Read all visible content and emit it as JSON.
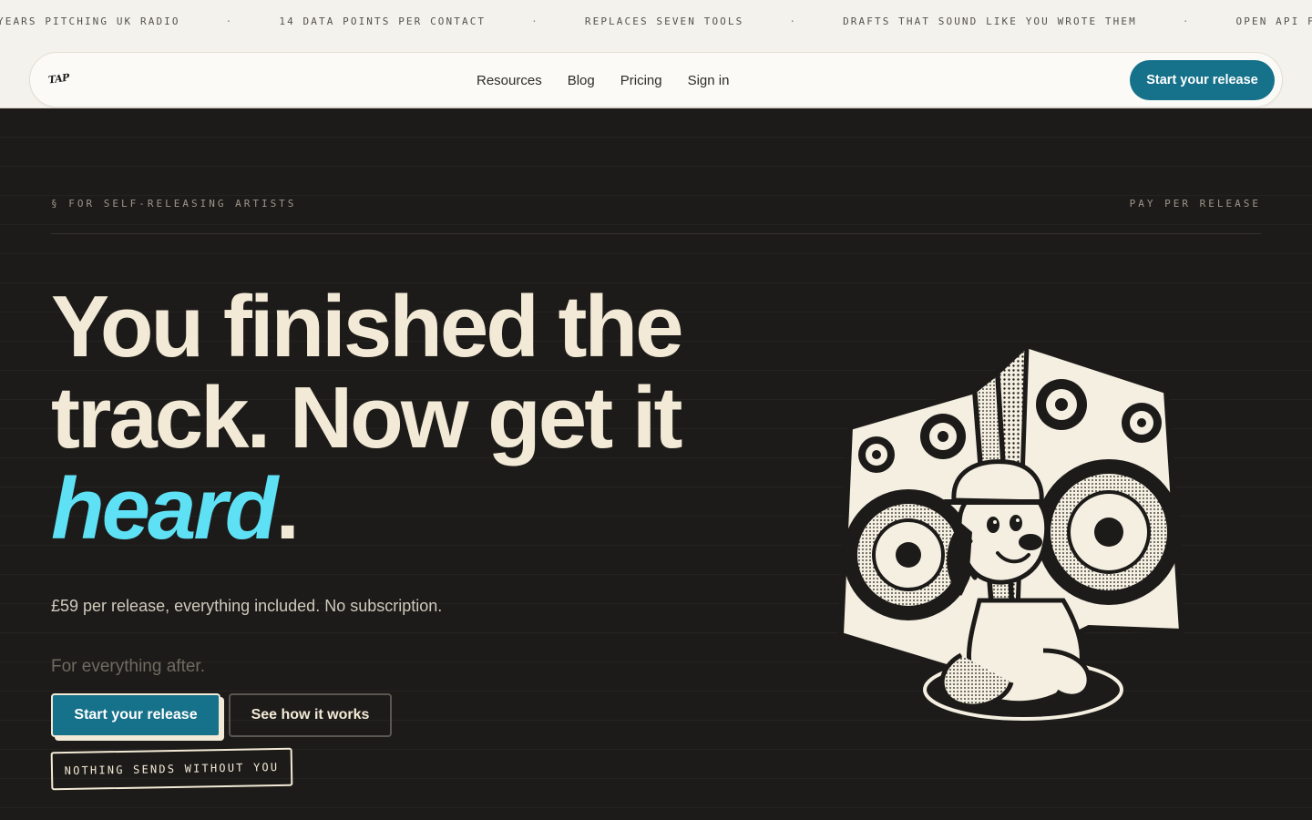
{
  "ticker": {
    "items": [
      "YEARS PITCHING UK RADIO",
      "14 DATA POINTS PER CONTACT",
      "REPLACES SEVEN TOOLS",
      "DRAFTS THAT SOUND LIKE YOU WROTE THEM",
      "OPEN API FROM DAY ONE"
    ],
    "separator": "·"
  },
  "header": {
    "logo": "TAP",
    "nav": [
      "Resources",
      "Blog",
      "Pricing",
      "Sign in"
    ],
    "cta": "Start your release"
  },
  "hero": {
    "eyebrow_left": "§ FOR SELF-RELEASING ARTISTS",
    "eyebrow_right": "PAY PER RELEASE",
    "headline_part1": "You finished the track. Now get it ",
    "headline_accent": "heard",
    "headline_end": ".",
    "subline": "£59 per release, everything included. No subscription.",
    "subline_2": "For everything after.",
    "primary_cta": "Start your release",
    "secondary_cta": "See how it works",
    "stamp": "NOTHING SENDS WITHOUT YOU"
  },
  "colors": {
    "background": "#1d1b19",
    "cream": "#f2ead6",
    "accent": "#5ee0f5",
    "brand": "#16718a"
  }
}
